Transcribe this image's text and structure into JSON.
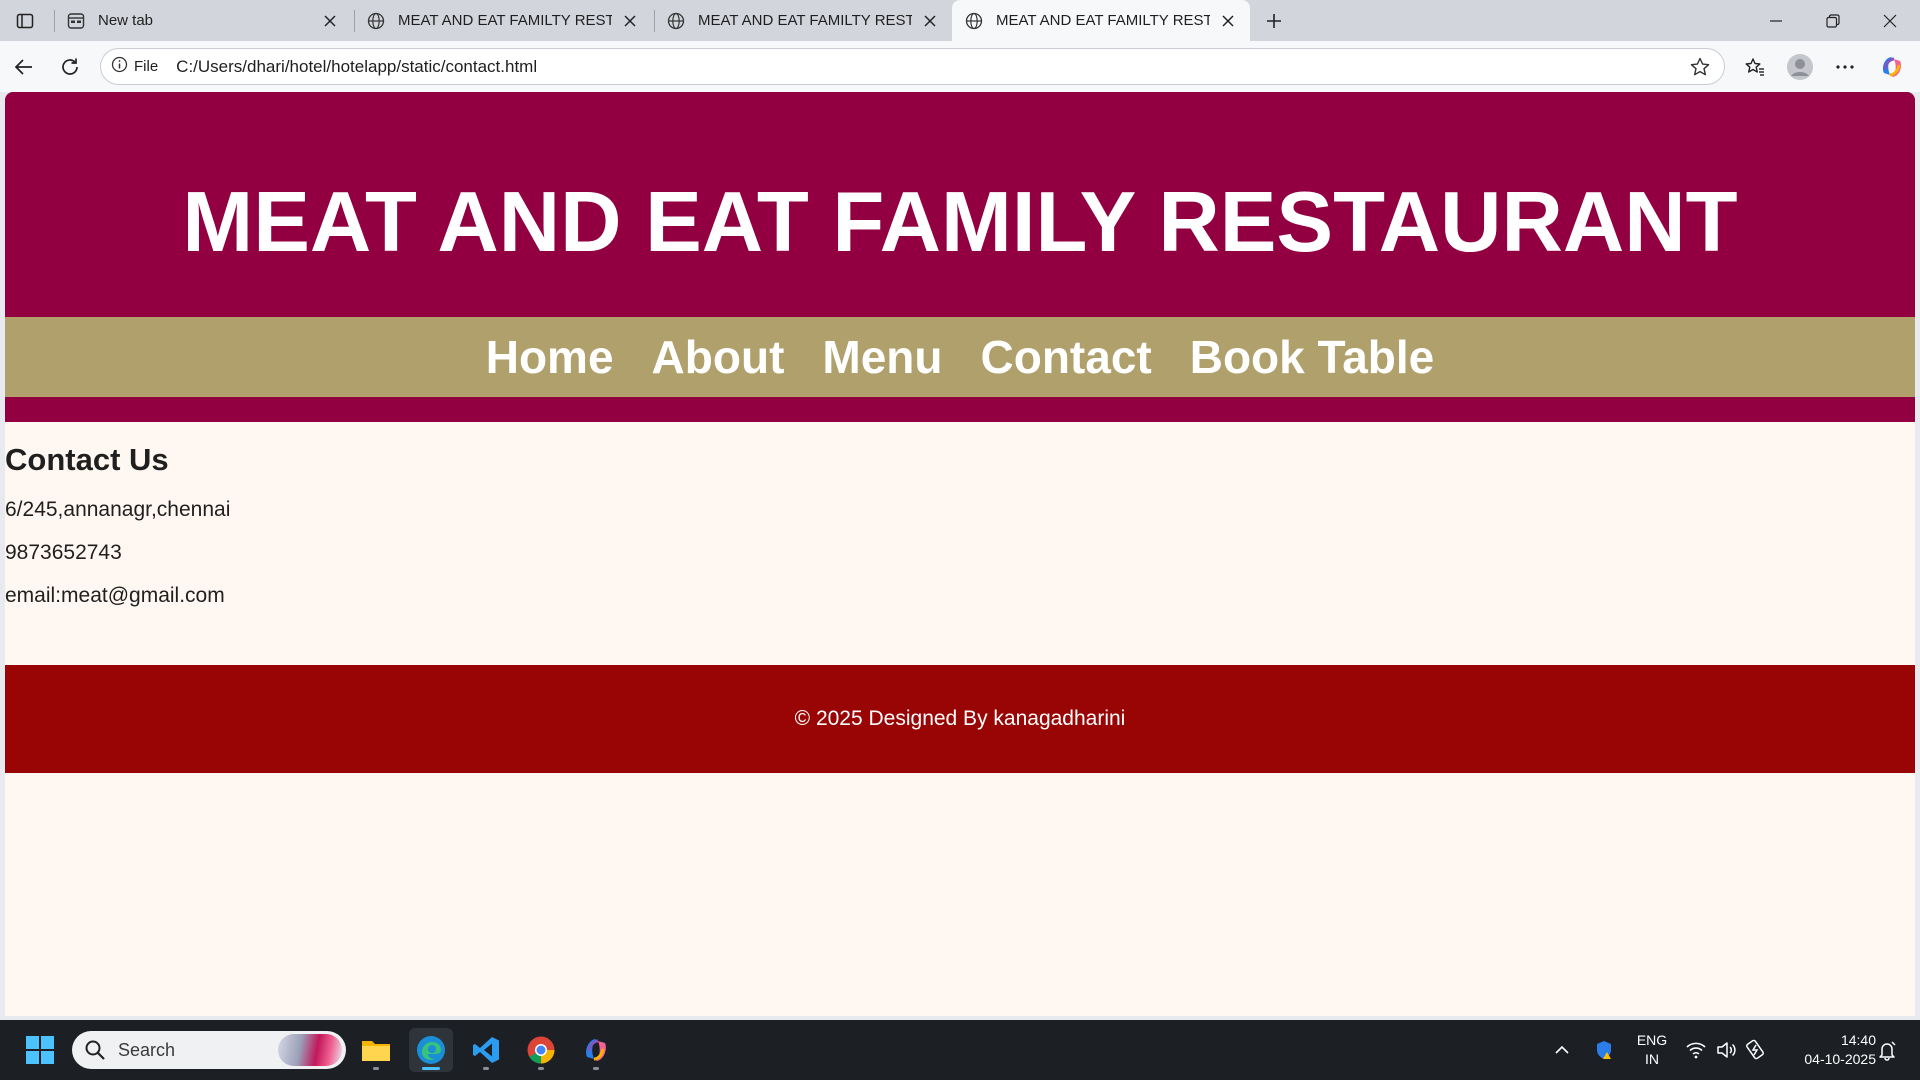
{
  "browser": {
    "tabs": [
      {
        "title": "New tab",
        "active": false,
        "icon": "new-tab-page-icon"
      },
      {
        "title": "MEAT AND EAT FAMILTY RESTAURANT",
        "active": false,
        "icon": "globe-icon"
      },
      {
        "title": "MEAT AND EAT FAMILTY RESTAURANT",
        "active": false,
        "icon": "globe-icon"
      },
      {
        "title": "MEAT AND EAT FAMILTY RESTAURANT",
        "active": true,
        "icon": "globe-icon"
      }
    ],
    "site_info_label": "File",
    "url": "C:/Users/dhari/hotel/hotelapp/static/contact.html"
  },
  "page": {
    "header_title": "MEAT AND EAT FAMILY RESTAURANT",
    "nav": [
      "Home",
      "About",
      "Menu",
      "Contact",
      "Book Table"
    ],
    "contact": {
      "heading": "Contact Us",
      "address": "6/245,annanagr,chennai",
      "phone": "9873652743",
      "email": "email:meat@gmail.com"
    },
    "footer": "© 2025 Designed By kanagadharini"
  },
  "colors": {
    "header_bg": "#930042",
    "nav_bg": "#b0a06b",
    "footer_bg": "#990505",
    "page_bg": "#fff8f2"
  },
  "taskbar": {
    "search_placeholder": "Search",
    "language": "ENG",
    "region": "IN",
    "time": "14:40",
    "date": "04-10-2025"
  }
}
